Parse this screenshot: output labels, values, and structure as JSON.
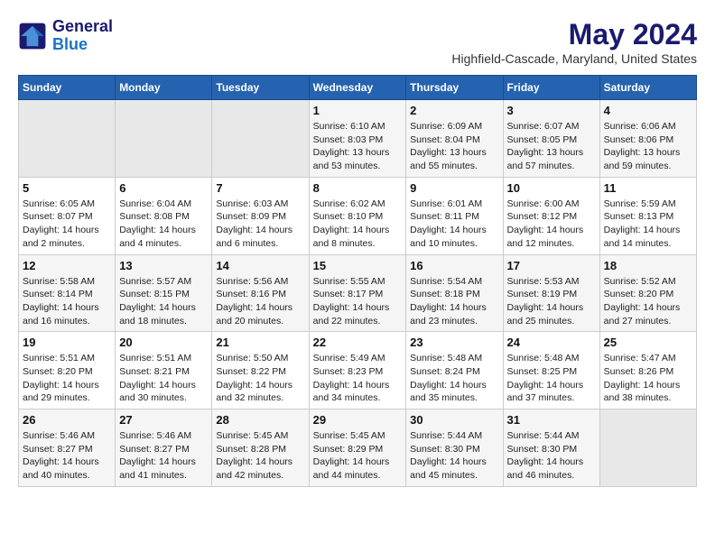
{
  "header": {
    "logo_line1": "General",
    "logo_line2": "Blue",
    "month_title": "May 2024",
    "location": "Highfield-Cascade, Maryland, United States"
  },
  "days_of_week": [
    "Sunday",
    "Monday",
    "Tuesday",
    "Wednesday",
    "Thursday",
    "Friday",
    "Saturday"
  ],
  "weeks": [
    [
      {
        "day": "",
        "sunrise": "",
        "sunset": "",
        "daylight": ""
      },
      {
        "day": "",
        "sunrise": "",
        "sunset": "",
        "daylight": ""
      },
      {
        "day": "",
        "sunrise": "",
        "sunset": "",
        "daylight": ""
      },
      {
        "day": "1",
        "sunrise": "Sunrise: 6:10 AM",
        "sunset": "Sunset: 8:03 PM",
        "daylight": "Daylight: 13 hours and 53 minutes."
      },
      {
        "day": "2",
        "sunrise": "Sunrise: 6:09 AM",
        "sunset": "Sunset: 8:04 PM",
        "daylight": "Daylight: 13 hours and 55 minutes."
      },
      {
        "day": "3",
        "sunrise": "Sunrise: 6:07 AM",
        "sunset": "Sunset: 8:05 PM",
        "daylight": "Daylight: 13 hours and 57 minutes."
      },
      {
        "day": "4",
        "sunrise": "Sunrise: 6:06 AM",
        "sunset": "Sunset: 8:06 PM",
        "daylight": "Daylight: 13 hours and 59 minutes."
      }
    ],
    [
      {
        "day": "5",
        "sunrise": "Sunrise: 6:05 AM",
        "sunset": "Sunset: 8:07 PM",
        "daylight": "Daylight: 14 hours and 2 minutes."
      },
      {
        "day": "6",
        "sunrise": "Sunrise: 6:04 AM",
        "sunset": "Sunset: 8:08 PM",
        "daylight": "Daylight: 14 hours and 4 minutes."
      },
      {
        "day": "7",
        "sunrise": "Sunrise: 6:03 AM",
        "sunset": "Sunset: 8:09 PM",
        "daylight": "Daylight: 14 hours and 6 minutes."
      },
      {
        "day": "8",
        "sunrise": "Sunrise: 6:02 AM",
        "sunset": "Sunset: 8:10 PM",
        "daylight": "Daylight: 14 hours and 8 minutes."
      },
      {
        "day": "9",
        "sunrise": "Sunrise: 6:01 AM",
        "sunset": "Sunset: 8:11 PM",
        "daylight": "Daylight: 14 hours and 10 minutes."
      },
      {
        "day": "10",
        "sunrise": "Sunrise: 6:00 AM",
        "sunset": "Sunset: 8:12 PM",
        "daylight": "Daylight: 14 hours and 12 minutes."
      },
      {
        "day": "11",
        "sunrise": "Sunrise: 5:59 AM",
        "sunset": "Sunset: 8:13 PM",
        "daylight": "Daylight: 14 hours and 14 minutes."
      }
    ],
    [
      {
        "day": "12",
        "sunrise": "Sunrise: 5:58 AM",
        "sunset": "Sunset: 8:14 PM",
        "daylight": "Daylight: 14 hours and 16 minutes."
      },
      {
        "day": "13",
        "sunrise": "Sunrise: 5:57 AM",
        "sunset": "Sunset: 8:15 PM",
        "daylight": "Daylight: 14 hours and 18 minutes."
      },
      {
        "day": "14",
        "sunrise": "Sunrise: 5:56 AM",
        "sunset": "Sunset: 8:16 PM",
        "daylight": "Daylight: 14 hours and 20 minutes."
      },
      {
        "day": "15",
        "sunrise": "Sunrise: 5:55 AM",
        "sunset": "Sunset: 8:17 PM",
        "daylight": "Daylight: 14 hours and 22 minutes."
      },
      {
        "day": "16",
        "sunrise": "Sunrise: 5:54 AM",
        "sunset": "Sunset: 8:18 PM",
        "daylight": "Daylight: 14 hours and 23 minutes."
      },
      {
        "day": "17",
        "sunrise": "Sunrise: 5:53 AM",
        "sunset": "Sunset: 8:19 PM",
        "daylight": "Daylight: 14 hours and 25 minutes."
      },
      {
        "day": "18",
        "sunrise": "Sunrise: 5:52 AM",
        "sunset": "Sunset: 8:20 PM",
        "daylight": "Daylight: 14 hours and 27 minutes."
      }
    ],
    [
      {
        "day": "19",
        "sunrise": "Sunrise: 5:51 AM",
        "sunset": "Sunset: 8:20 PM",
        "daylight": "Daylight: 14 hours and 29 minutes."
      },
      {
        "day": "20",
        "sunrise": "Sunrise: 5:51 AM",
        "sunset": "Sunset: 8:21 PM",
        "daylight": "Daylight: 14 hours and 30 minutes."
      },
      {
        "day": "21",
        "sunrise": "Sunrise: 5:50 AM",
        "sunset": "Sunset: 8:22 PM",
        "daylight": "Daylight: 14 hours and 32 minutes."
      },
      {
        "day": "22",
        "sunrise": "Sunrise: 5:49 AM",
        "sunset": "Sunset: 8:23 PM",
        "daylight": "Daylight: 14 hours and 34 minutes."
      },
      {
        "day": "23",
        "sunrise": "Sunrise: 5:48 AM",
        "sunset": "Sunset: 8:24 PM",
        "daylight": "Daylight: 14 hours and 35 minutes."
      },
      {
        "day": "24",
        "sunrise": "Sunrise: 5:48 AM",
        "sunset": "Sunset: 8:25 PM",
        "daylight": "Daylight: 14 hours and 37 minutes."
      },
      {
        "day": "25",
        "sunrise": "Sunrise: 5:47 AM",
        "sunset": "Sunset: 8:26 PM",
        "daylight": "Daylight: 14 hours and 38 minutes."
      }
    ],
    [
      {
        "day": "26",
        "sunrise": "Sunrise: 5:46 AM",
        "sunset": "Sunset: 8:27 PM",
        "daylight": "Daylight: 14 hours and 40 minutes."
      },
      {
        "day": "27",
        "sunrise": "Sunrise: 5:46 AM",
        "sunset": "Sunset: 8:27 PM",
        "daylight": "Daylight: 14 hours and 41 minutes."
      },
      {
        "day": "28",
        "sunrise": "Sunrise: 5:45 AM",
        "sunset": "Sunset: 8:28 PM",
        "daylight": "Daylight: 14 hours and 42 minutes."
      },
      {
        "day": "29",
        "sunrise": "Sunrise: 5:45 AM",
        "sunset": "Sunset: 8:29 PM",
        "daylight": "Daylight: 14 hours and 44 minutes."
      },
      {
        "day": "30",
        "sunrise": "Sunrise: 5:44 AM",
        "sunset": "Sunset: 8:30 PM",
        "daylight": "Daylight: 14 hours and 45 minutes."
      },
      {
        "day": "31",
        "sunrise": "Sunrise: 5:44 AM",
        "sunset": "Sunset: 8:30 PM",
        "daylight": "Daylight: 14 hours and 46 minutes."
      },
      {
        "day": "",
        "sunrise": "",
        "sunset": "",
        "daylight": ""
      }
    ]
  ]
}
